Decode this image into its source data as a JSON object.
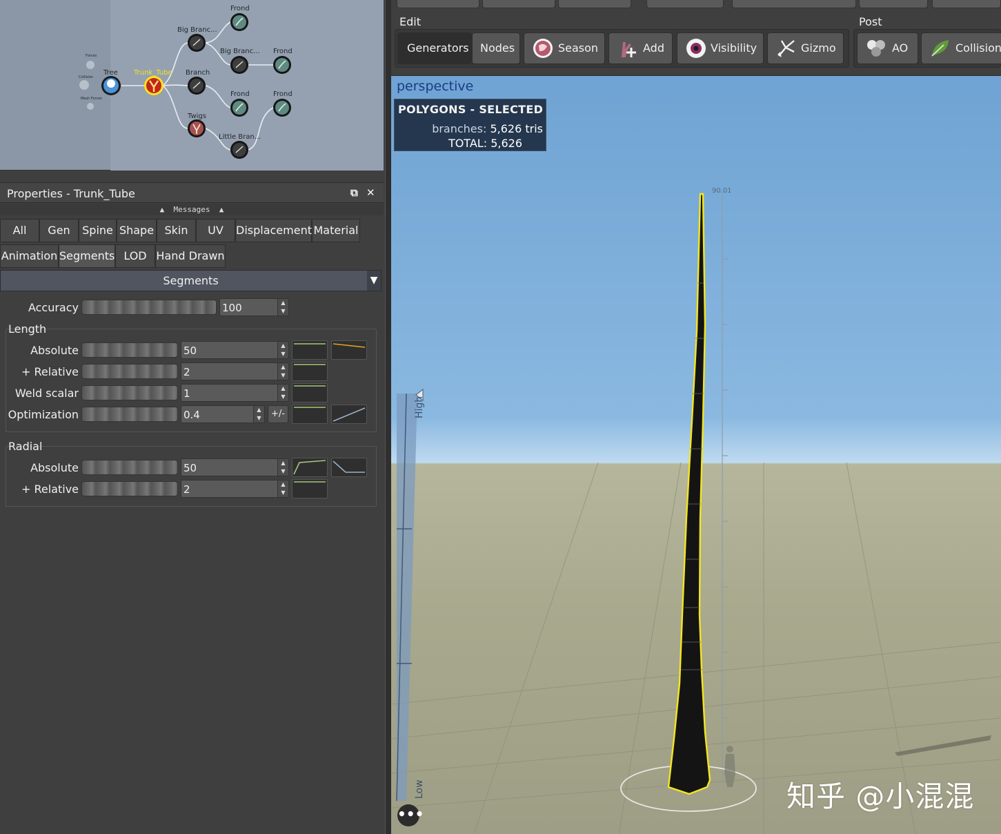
{
  "node_graph": {
    "nodes": [
      {
        "id": "tree",
        "label": "Tree"
      },
      {
        "id": "trunk",
        "label": "Trunk_Tube"
      },
      {
        "id": "big1",
        "label": "Big Branc..."
      },
      {
        "id": "big2",
        "label": "Big Branc..."
      },
      {
        "id": "branch",
        "label": "Branch"
      },
      {
        "id": "twigs",
        "label": "Twigs"
      },
      {
        "id": "little",
        "label": "Little Bran..."
      },
      {
        "id": "frond1",
        "label": "Frond"
      },
      {
        "id": "frond2",
        "label": "Frond"
      },
      {
        "id": "frond3",
        "label": "Frond"
      },
      {
        "id": "frond4",
        "label": "Frond"
      }
    ],
    "left_labels": [
      "Forces",
      "Collision",
      "Mesh Forces"
    ]
  },
  "properties": {
    "title": "Properties - Trunk_Tube",
    "messages": "Messages",
    "tabs_row1": [
      "All",
      "Gen",
      "Spine",
      "Shape",
      "Skin",
      "UV",
      "Displacement",
      "Material"
    ],
    "tabs_row2": [
      "Animation",
      "Segments",
      "LOD",
      "Hand Drawn"
    ],
    "active_tab": "Segments",
    "section": "Segments",
    "accuracy": {
      "label": "Accuracy",
      "value": "100"
    },
    "length": {
      "label": "Length",
      "rows": [
        {
          "label": "Absolute",
          "value": "50"
        },
        {
          "label": "+ Relative",
          "value": "2"
        },
        {
          "label": "Weld scalar",
          "value": "1"
        },
        {
          "label": "Optimization",
          "value": "0.4",
          "pm": "+/-"
        }
      ]
    },
    "radial": {
      "label": "Radial",
      "rows": [
        {
          "label": "Absolute",
          "value": "50"
        },
        {
          "label": "+ Relative",
          "value": "2"
        }
      ]
    }
  },
  "toolbar": {
    "edit_label": "Edit",
    "post_label": "Post",
    "buttons": {
      "generators": "Generators",
      "nodes": "Nodes",
      "season": "Season",
      "add": "Add",
      "visibility": "Visibility",
      "gizmo": "Gizmo",
      "ao": "AO",
      "collision": "Collision"
    }
  },
  "viewport": {
    "title": "perspective",
    "stats_header": "POLYGONS - SELECTED",
    "branches_label": "branches:",
    "branches_value": "5,626 tris",
    "total_label": "TOTAL:",
    "total_value": "5,626",
    "height_readout": "90.01",
    "scale_high": "High",
    "scale_low": "Low",
    "watermark": "知乎 @小混混"
  },
  "colors": {
    "selection_outline": "#f5e61e",
    "curve_green": "#a7c97a",
    "curve_orange": "#e1a21e",
    "sky": "#78aedc",
    "ground": "#a8a88e"
  }
}
